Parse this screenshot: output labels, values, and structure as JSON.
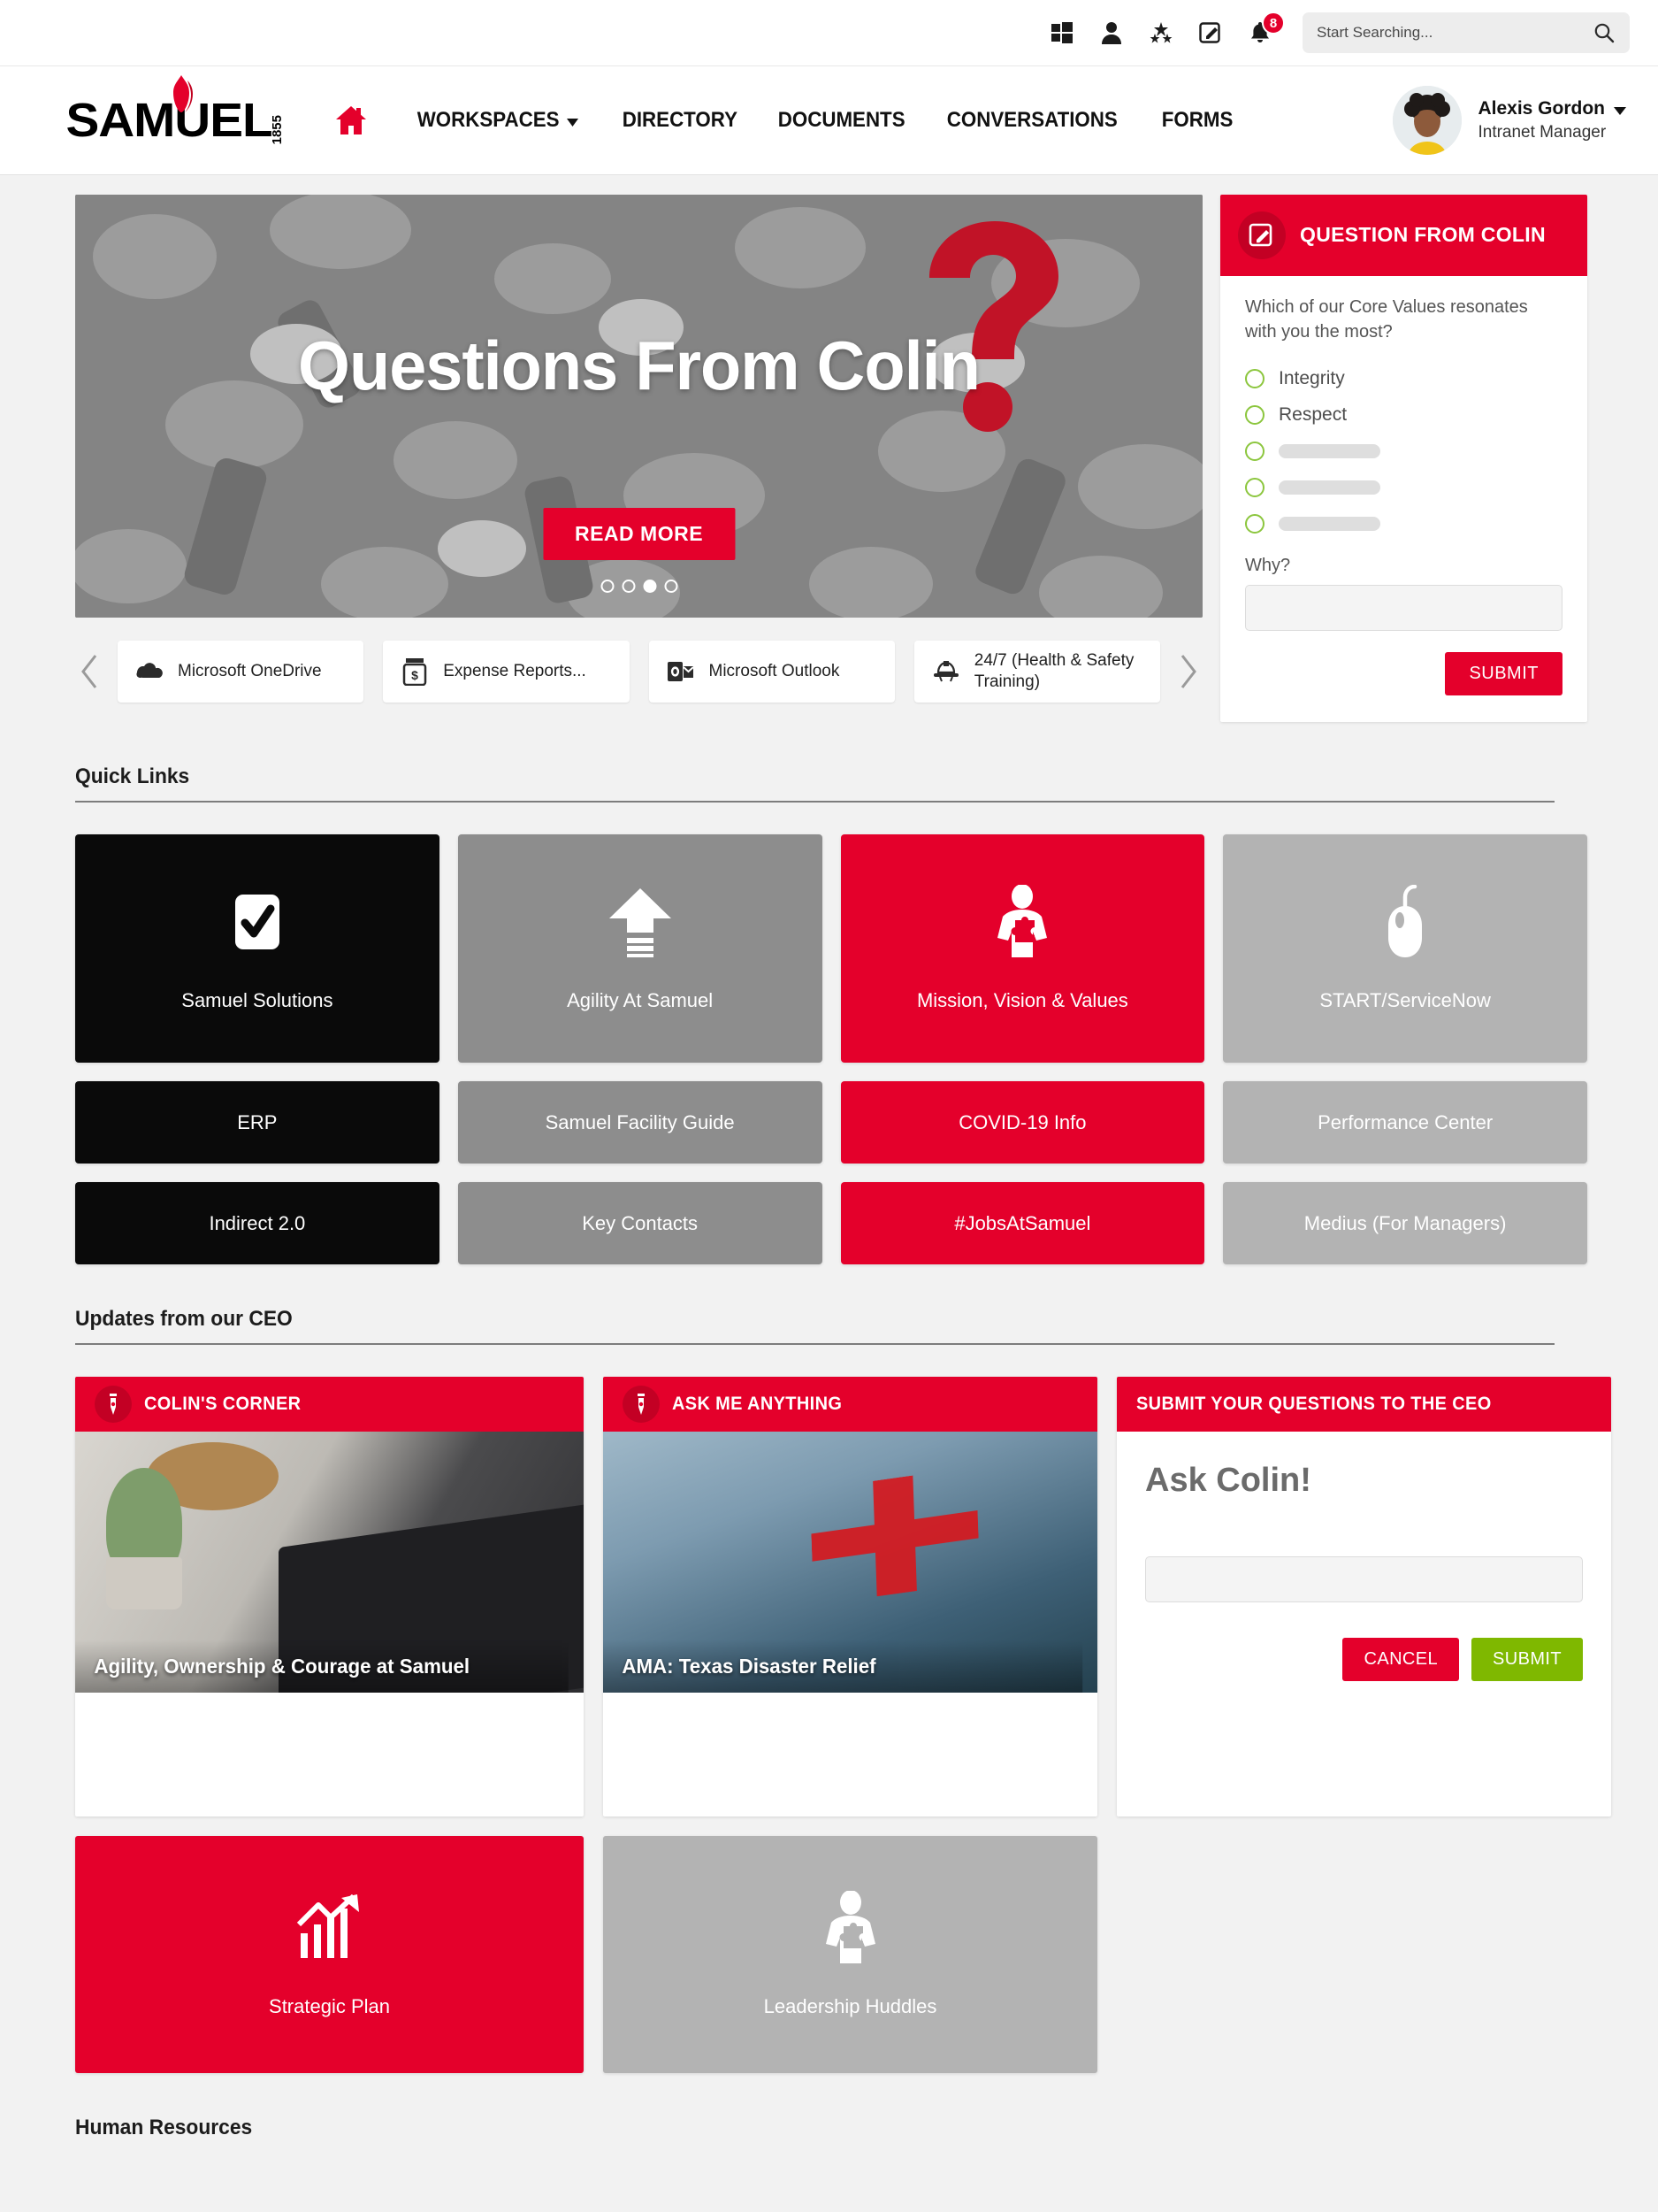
{
  "topbar": {
    "icons": [
      {
        "name": "windows-grid-icon"
      },
      {
        "name": "person-icon"
      },
      {
        "name": "stars-icon"
      },
      {
        "name": "compose-icon"
      },
      {
        "name": "bell-icon"
      }
    ],
    "notification_count": "8",
    "search_placeholder": "Start Searching...",
    "search_value": ""
  },
  "brand": {
    "wordmark": "SAMUEL",
    "year": "1855"
  },
  "nav": {
    "home_icon": "home-icon",
    "items": [
      {
        "label": "WORKSPACES",
        "has_dropdown": true
      },
      {
        "label": "DIRECTORY",
        "has_dropdown": false
      },
      {
        "label": "DOCUMENTS",
        "has_dropdown": false
      },
      {
        "label": "CONVERSATIONS",
        "has_dropdown": false
      },
      {
        "label": "FORMS",
        "has_dropdown": false
      }
    ]
  },
  "user": {
    "name": "Alexis Gordon",
    "role": "Intranet Manager"
  },
  "hero": {
    "title": "Questions From Colin",
    "button": "READ MORE",
    "slide_count": 4,
    "active_slide": 3
  },
  "apps": {
    "prev_label": "‹",
    "next_label": "›",
    "items": [
      {
        "label": "Microsoft OneDrive",
        "icon": "onedrive-cloud-icon"
      },
      {
        "label": "Expense Reports...",
        "icon": "expense-jar-icon"
      },
      {
        "label": "Microsoft Outlook",
        "icon": "outlook-icon"
      },
      {
        "label": "24/7 (Health & Safety Training)",
        "icon": "hard-hat-icon"
      }
    ]
  },
  "poll": {
    "header": "QUESTION FROM COLIN",
    "header_icon": "compose-icon",
    "question": "Which of our Core Values resonates with you the most?",
    "options": [
      {
        "label": "Integrity",
        "blank": false
      },
      {
        "label": "Respect",
        "blank": false
      },
      {
        "label": "",
        "blank": true
      },
      {
        "label": "",
        "blank": true
      },
      {
        "label": "",
        "blank": true
      }
    ],
    "why_label": "Why?",
    "why_value": "",
    "why_placeholder": "",
    "submit": "SUBMIT"
  },
  "quick_links": {
    "title": "Quick Links",
    "featured": [
      {
        "label": "Samuel Solutions",
        "icon": "check-square-icon",
        "color": "#0a0a0a"
      },
      {
        "label": "Agility At Samuel",
        "icon": "upload-arrow-icon",
        "color": "#8d8d8d"
      },
      {
        "label": "Mission, Vision & Values",
        "icon": "person-puzzle-icon",
        "color": "#e4002b"
      },
      {
        "label": "START/ServiceNow",
        "icon": "mouse-icon",
        "color": "#b3b3b3"
      }
    ],
    "rows": [
      [
        {
          "label": "ERP",
          "color": "#0a0a0a"
        },
        {
          "label": "Samuel Facility Guide",
          "color": "#8d8d8d"
        },
        {
          "label": "COVID-19 Info",
          "color": "#e4002b"
        },
        {
          "label": "Performance Center",
          "color": "#b3b3b3"
        }
      ],
      [
        {
          "label": "Indirect 2.0",
          "color": "#0a0a0a"
        },
        {
          "label": "Key Contacts",
          "color": "#8d8d8d"
        },
        {
          "label": "#JobsAtSamuel",
          "color": "#e4002b"
        },
        {
          "label": "Medius (For Managers)",
          "color": "#b3b3b3"
        }
      ]
    ]
  },
  "ceo": {
    "title": "Updates from our CEO",
    "cards": [
      {
        "header": "COLIN'S CORNER",
        "icon": "pen-nib-icon",
        "caption": "Agility, Ownership & Courage at Samuel"
      },
      {
        "header": "ASK ME ANYTHING",
        "icon": "pen-nib-icon",
        "caption": "AMA: Texas Disaster Relief"
      }
    ],
    "ask": {
      "header": "SUBMIT YOUR QUESTIONS TO THE CEO",
      "title": "Ask Colin!",
      "input_value": "",
      "input_placeholder": "",
      "cancel": "CANCEL",
      "submit": "SUBMIT"
    },
    "tiles": [
      {
        "label": "Strategic Plan",
        "icon": "growth-chart-icon",
        "color": "#e4002b"
      },
      {
        "label": "Leadership Huddles",
        "icon": "person-puzzle-icon",
        "color": "#b3b3b3"
      }
    ]
  },
  "hr": {
    "title": "Human Resources"
  },
  "colors": {
    "brand_red": "#e4002b",
    "green": "#7fb800",
    "radio_green": "#8cc63e",
    "page_bg": "#f2f2f2"
  }
}
